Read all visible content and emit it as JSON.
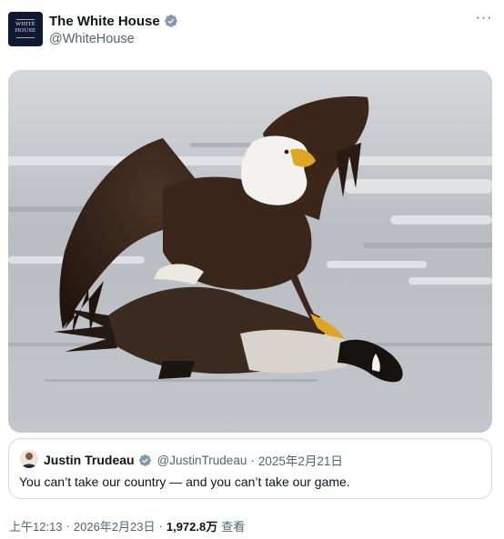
{
  "author": {
    "display_name": "The White House",
    "handle": "@WhiteHouse",
    "avatar_text": "WHITE HOUSE",
    "verified_color": "#829aab"
  },
  "menu": {
    "more_label": "···"
  },
  "media": {
    "icon": "photo-bald-eagle-on-goose"
  },
  "quote": {
    "author_name": "Justin Trudeau",
    "author_handle": "@JustinTrudeau",
    "separator": "·",
    "date": "2025年2月21日",
    "text": "You can’t take our country — and you can’t take our game.",
    "verified_color": "#1d9bf0"
  },
  "meta": {
    "time": "上午12:13",
    "separator": "·",
    "date": "2026年2月23日",
    "views_count": "1,972.8万",
    "views_label": "查看"
  }
}
